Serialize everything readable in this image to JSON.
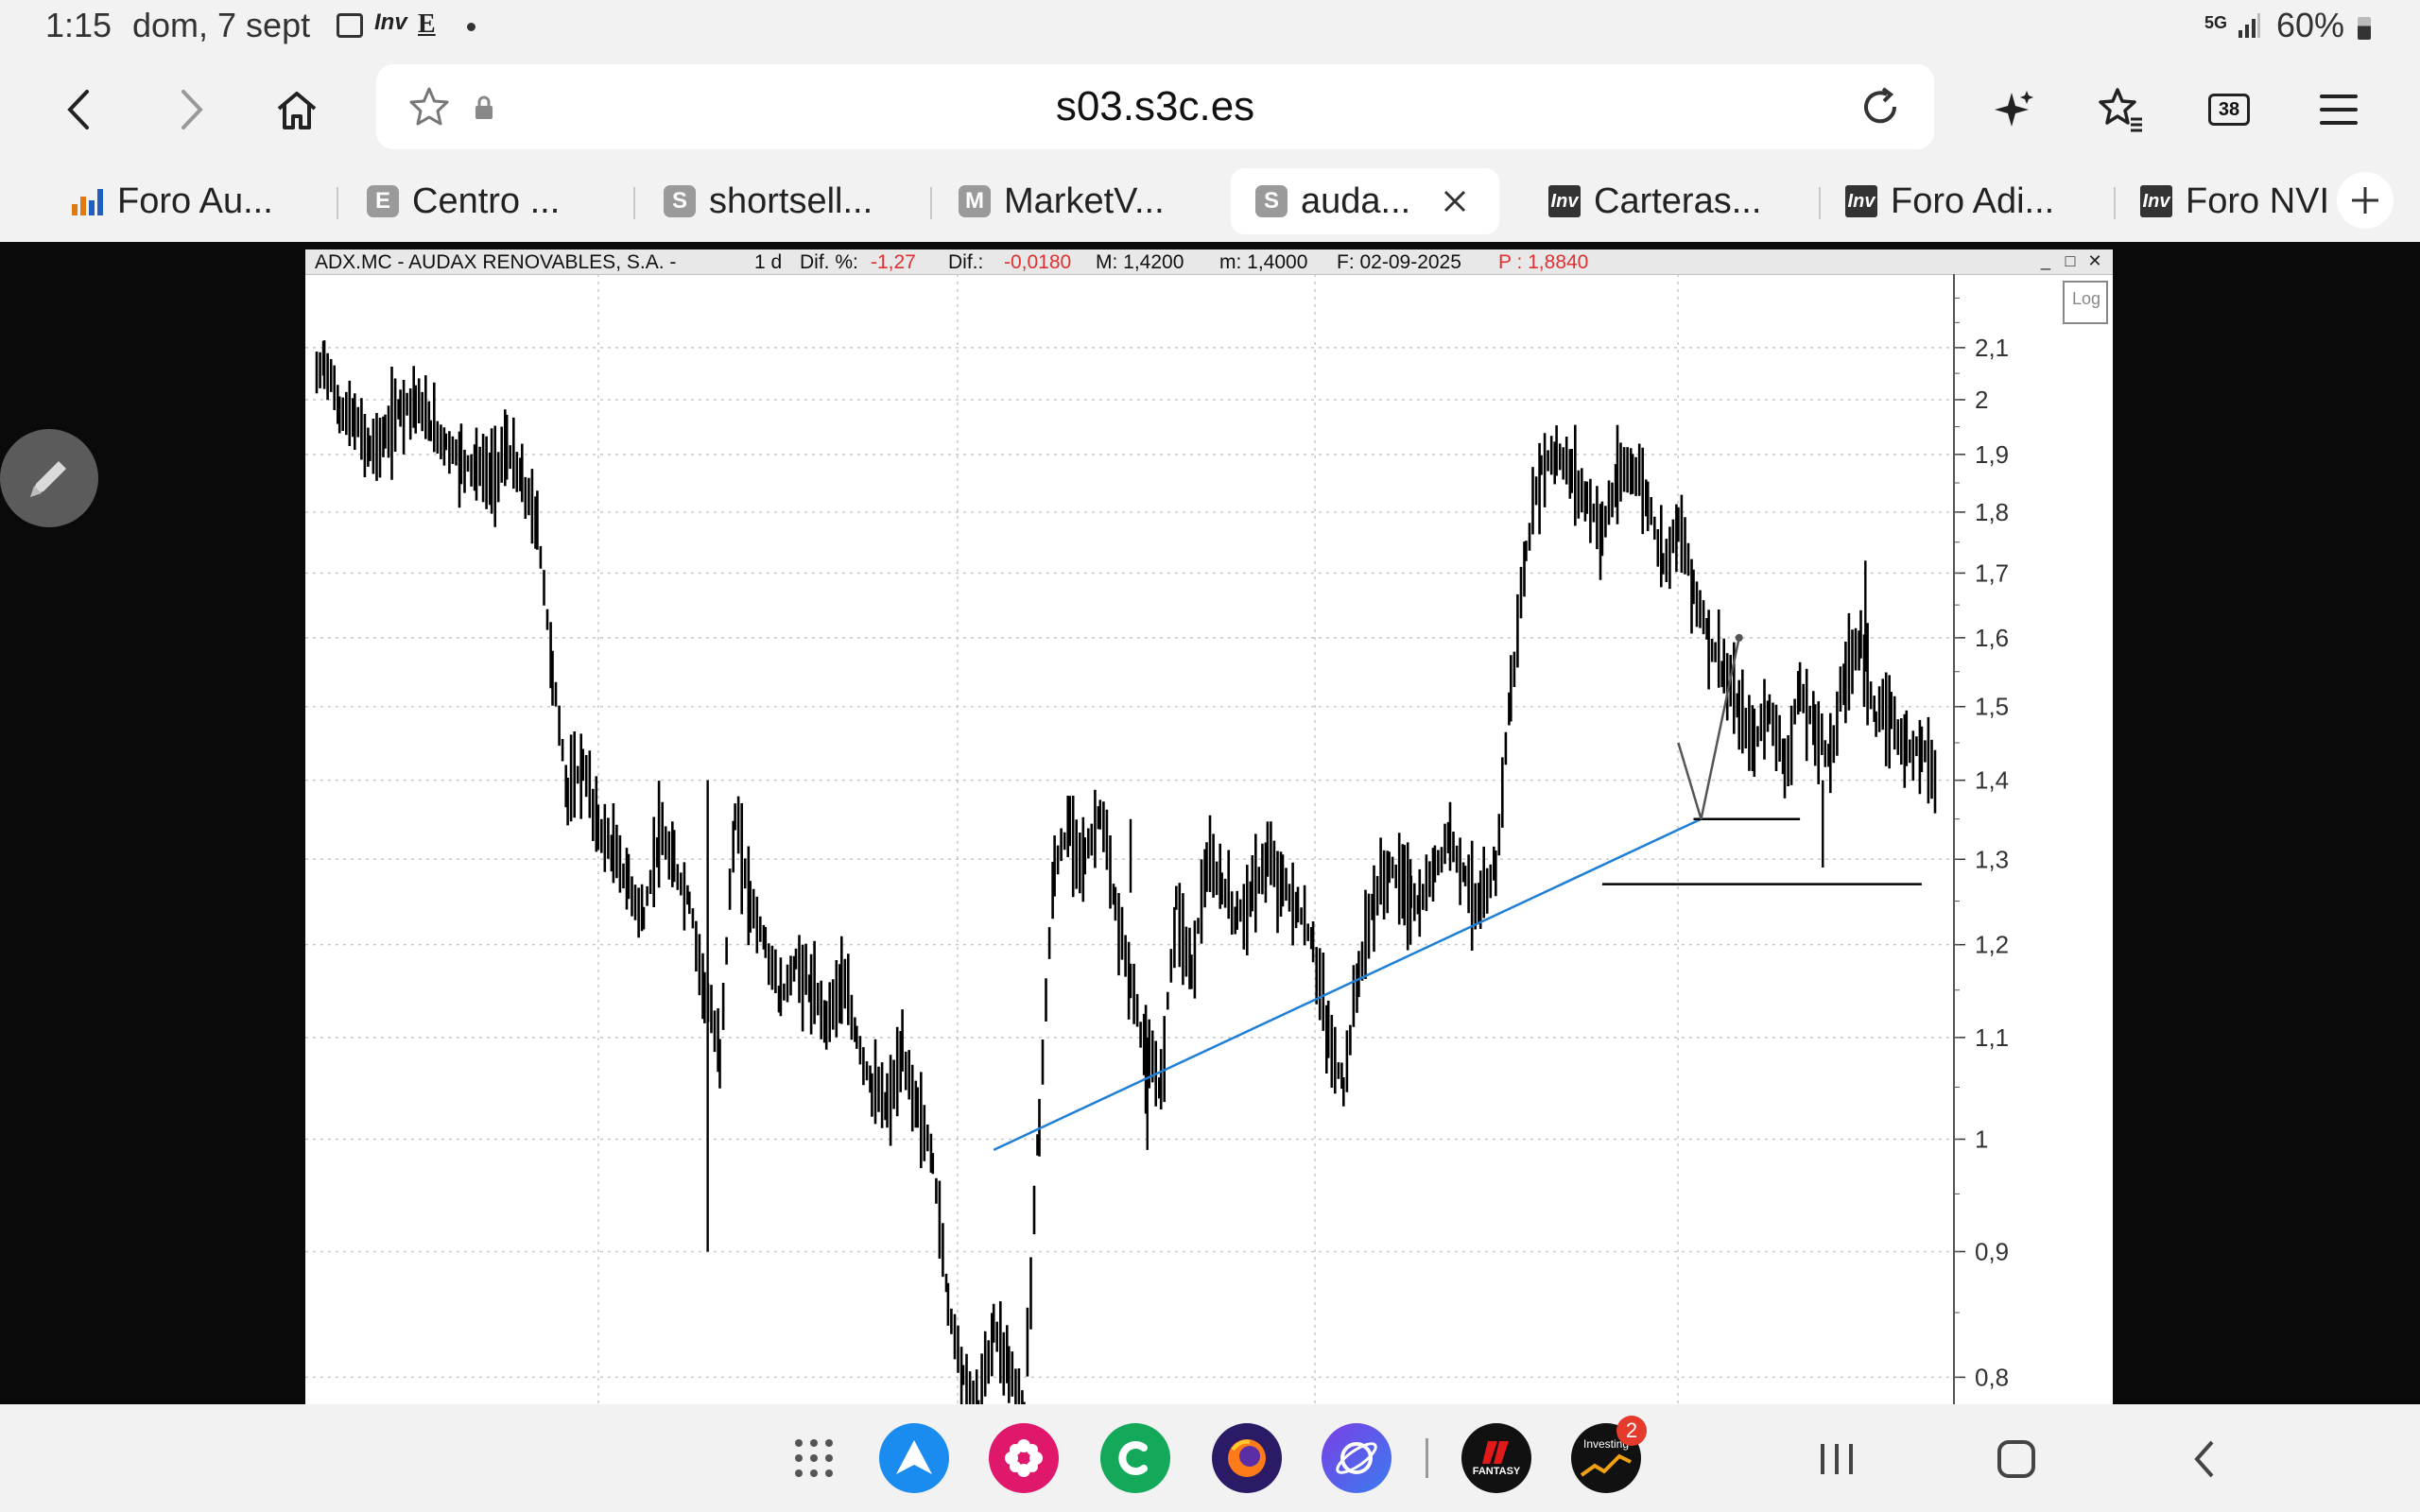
{
  "status": {
    "time": "1:15",
    "date": "dom, 7 sept",
    "notif_inv": "Inv",
    "notif_e": "E",
    "network": "5G",
    "battery": "60%"
  },
  "browser": {
    "url": "s03.s3c.es",
    "tab_count": "38",
    "tabs": [
      {
        "label": "Foro Au...",
        "favicon": "chart-bar-icon"
      },
      {
        "label": "Centro ...",
        "favicon": "E"
      },
      {
        "label": "shortsell...",
        "favicon": "S"
      },
      {
        "label": "MarketV...",
        "favicon": "M"
      },
      {
        "label": "auda...",
        "favicon": "S"
      },
      {
        "label": "Carteras...",
        "favicon": "Inv"
      },
      {
        "label": "Foro Adi...",
        "favicon": "Inv"
      },
      {
        "label": "Foro NVI",
        "favicon": "Inv"
      }
    ]
  },
  "chart_window": {
    "symbol": "ADX.MC - AUDAX RENOVABLES, S.A. -",
    "period": "1 d",
    "dif_pct_label": "Dif. %:",
    "dif_pct": "-1,27",
    "dif_label": "Dif.:",
    "dif": "-0,0180",
    "max": "M: 1,4200",
    "min": "m: 1,4000",
    "date": "F: 02-09-2025",
    "price": "P : 1,8840",
    "log_button": "Log"
  },
  "chart_data": {
    "type": "line",
    "title": "ADX.MC - AUDAX RENOVABLES, S.A.",
    "y_scale": "log",
    "ylim": [
      0.78,
      2.25
    ],
    "y_ticks": [
      "2,1",
      "2",
      "1,9",
      "1,8",
      "1,7",
      "1,6",
      "1,5",
      "1,4",
      "1,3",
      "1,2",
      "1,1",
      "1",
      "0,9",
      "0,8"
    ],
    "y_tick_values": [
      2.1,
      2.0,
      1.9,
      1.8,
      1.7,
      1.6,
      1.5,
      1.4,
      1.3,
      1.2,
      1.1,
      1.0,
      0.9,
      0.8
    ],
    "grid": true,
    "x_range": [
      0,
      100
    ],
    "series": [
      {
        "values": [
          [
            0.5,
            2.04
          ],
          [
            1,
            2.08
          ],
          [
            2,
            1.98
          ],
          [
            3,
            1.96
          ],
          [
            4,
            1.91
          ],
          [
            5,
            1.93
          ],
          [
            6,
            1.99
          ],
          [
            7,
            2.0
          ],
          [
            8,
            1.95
          ],
          [
            9,
            1.92
          ],
          [
            10,
            1.89
          ],
          [
            11,
            1.88
          ],
          [
            12,
            1.86
          ],
          [
            13,
            1.91
          ],
          [
            14,
            1.85
          ],
          [
            15,
            1.78
          ],
          [
            16,
            1.55
          ],
          [
            17,
            1.38
          ],
          [
            18,
            1.42
          ],
          [
            19,
            1.34
          ],
          [
            20,
            1.31
          ],
          [
            21,
            1.27
          ],
          [
            22,
            1.23
          ],
          [
            23,
            1.33
          ],
          [
            24,
            1.29
          ],
          [
            25,
            1.25
          ],
          [
            26,
            1.15
          ],
          [
            27,
            1.08
          ],
          [
            28,
            1.35
          ],
          [
            29,
            1.25
          ],
          [
            30,
            1.2
          ],
          [
            31,
            1.14
          ],
          [
            32,
            1.18
          ],
          [
            33,
            1.15
          ],
          [
            34,
            1.12
          ],
          [
            35,
            1.16
          ],
          [
            36,
            1.1
          ],
          [
            37,
            1.05
          ],
          [
            38,
            1.03
          ],
          [
            39,
            1.08
          ],
          [
            40,
            1.03
          ],
          [
            41,
            0.98
          ],
          [
            42,
            0.86
          ],
          [
            43,
            0.8
          ],
          [
            44,
            0.77
          ],
          [
            45,
            0.84
          ],
          [
            46,
            0.81
          ],
          [
            47,
            0.77
          ],
          [
            48,
            1.02
          ],
          [
            49,
            1.29
          ],
          [
            50,
            1.34
          ],
          [
            51,
            1.3
          ],
          [
            52,
            1.36
          ],
          [
            53,
            1.24
          ],
          [
            54,
            1.16
          ],
          [
            55,
            1.08
          ],
          [
            56,
            1.05
          ],
          [
            57,
            1.25
          ],
          [
            58,
            1.17
          ],
          [
            59,
            1.29
          ],
          [
            60,
            1.27
          ],
          [
            61,
            1.23
          ],
          [
            62,
            1.26
          ],
          [
            63,
            1.3
          ],
          [
            64,
            1.27
          ],
          [
            65,
            1.24
          ],
          [
            66,
            1.2
          ],
          [
            67,
            1.1
          ],
          [
            68,
            1.05
          ],
          [
            69,
            1.17
          ],
          [
            70,
            1.25
          ],
          [
            71,
            1.29
          ],
          [
            72,
            1.27
          ],
          [
            73,
            1.24
          ],
          [
            74,
            1.29
          ],
          [
            75,
            1.33
          ],
          [
            76,
            1.28
          ],
          [
            77,
            1.24
          ],
          [
            78,
            1.29
          ],
          [
            79,
            1.52
          ],
          [
            80,
            1.73
          ],
          [
            81,
            1.88
          ],
          [
            82,
            1.9
          ],
          [
            83,
            1.87
          ],
          [
            84,
            1.82
          ],
          [
            85,
            1.77
          ],
          [
            86,
            1.85
          ],
          [
            87,
            1.88
          ],
          [
            88,
            1.82
          ],
          [
            89,
            1.72
          ],
          [
            90,
            1.78
          ],
          [
            91,
            1.68
          ],
          [
            92,
            1.6
          ],
          [
            93,
            1.55
          ],
          [
            94,
            1.49
          ],
          [
            95,
            1.45
          ],
          [
            96,
            1.5
          ],
          [
            97,
            1.42
          ],
          [
            98,
            1.52
          ],
          [
            99,
            1.47
          ],
          [
            100,
            1.43
          ],
          [
            101,
            1.55
          ],
          [
            102,
            1.6
          ],
          [
            103,
            1.48
          ],
          [
            104,
            1.49
          ],
          [
            105,
            1.44
          ],
          [
            106,
            1.45
          ],
          [
            107,
            1.41
          ]
        ]
      }
    ],
    "annotations": [
      {
        "type": "trendline",
        "color": "#1f7fd6",
        "from": [
          45.0,
          0.99
        ],
        "to": [
          91.5,
          1.35
        ]
      },
      {
        "type": "hline",
        "color": "#000000",
        "y": 1.27,
        "x_from": 85,
        "x_to": 106
      },
      {
        "type": "hline",
        "color": "#000000",
        "y": 1.35,
        "x_from": 91,
        "x_to": 98
      },
      {
        "type": "arrow-path",
        "color": "#555555",
        "points": [
          [
            90,
            1.45
          ],
          [
            91.5,
            1.35
          ],
          [
            94,
            1.6
          ]
        ]
      }
    ]
  },
  "dock": {
    "apps": [
      "app-drawer-icon",
      "app-store-icon",
      "flower-app-icon",
      "c-app-icon",
      "firefox-icon",
      "internet-app-icon",
      "fantasy-app-icon",
      "investing-app-icon"
    ],
    "investing_badge": "2",
    "fantasy_label": "FANTASY",
    "investing_label": "Investing"
  }
}
